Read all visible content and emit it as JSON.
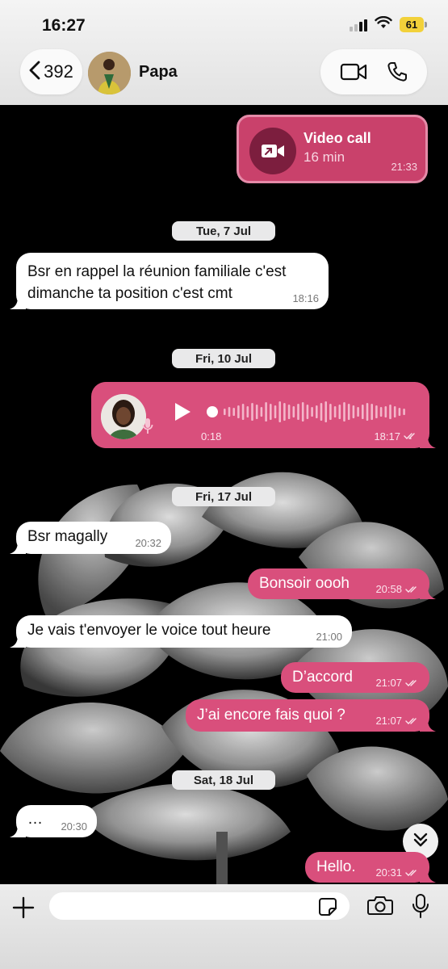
{
  "status_bar": {
    "time": "16:27",
    "battery": "61"
  },
  "header": {
    "back_count": "392",
    "contact_name": "Papa"
  },
  "video_call": {
    "title": "Video call",
    "duration": "16 min",
    "time": "21:33"
  },
  "dates": {
    "d1": "Tue, 7 Jul",
    "d2": "Fri, 10 Jul",
    "d3": "Fri, 17 Jul",
    "d4": "Sat, 18 Jul"
  },
  "messages": {
    "m1": {
      "line1": "Bsr en rappel la réunion familiale c'est",
      "line2": "dimanche ta position c'est cmt",
      "time": "18:16"
    },
    "voice": {
      "duration": "0:18",
      "time": "18:17"
    },
    "m2": {
      "text": "Bsr magally",
      "time": "20:32"
    },
    "m3": {
      "text": "Bonsoir oooh",
      "time": "20:58"
    },
    "m4": {
      "text": "Je vais t'envoyer le voice tout heure",
      "time": "21:00"
    },
    "m5": {
      "text": "D’accord",
      "time": "21:07"
    },
    "m6": {
      "text": "J’ai encore fais quoi ?",
      "time": "21:07"
    },
    "m7": {
      "text": "…",
      "time": "20:30"
    },
    "m8": {
      "text": "Hello.",
      "time": "20:31"
    }
  },
  "input": {
    "placeholder": ""
  },
  "icons": {
    "back": "chevron-left-icon",
    "video": "video-camera-icon",
    "phone": "phone-icon",
    "play": "play-icon",
    "mic": "microphone-icon",
    "plus": "plus-icon",
    "sticker": "sticker-icon",
    "camera": "camera-icon",
    "scroll": "double-chevron-down-icon"
  },
  "colors": {
    "outgoing": "#d94f7c",
    "incoming": "#ffffff",
    "video_call_card": "#c9416b",
    "background": "#000000"
  }
}
